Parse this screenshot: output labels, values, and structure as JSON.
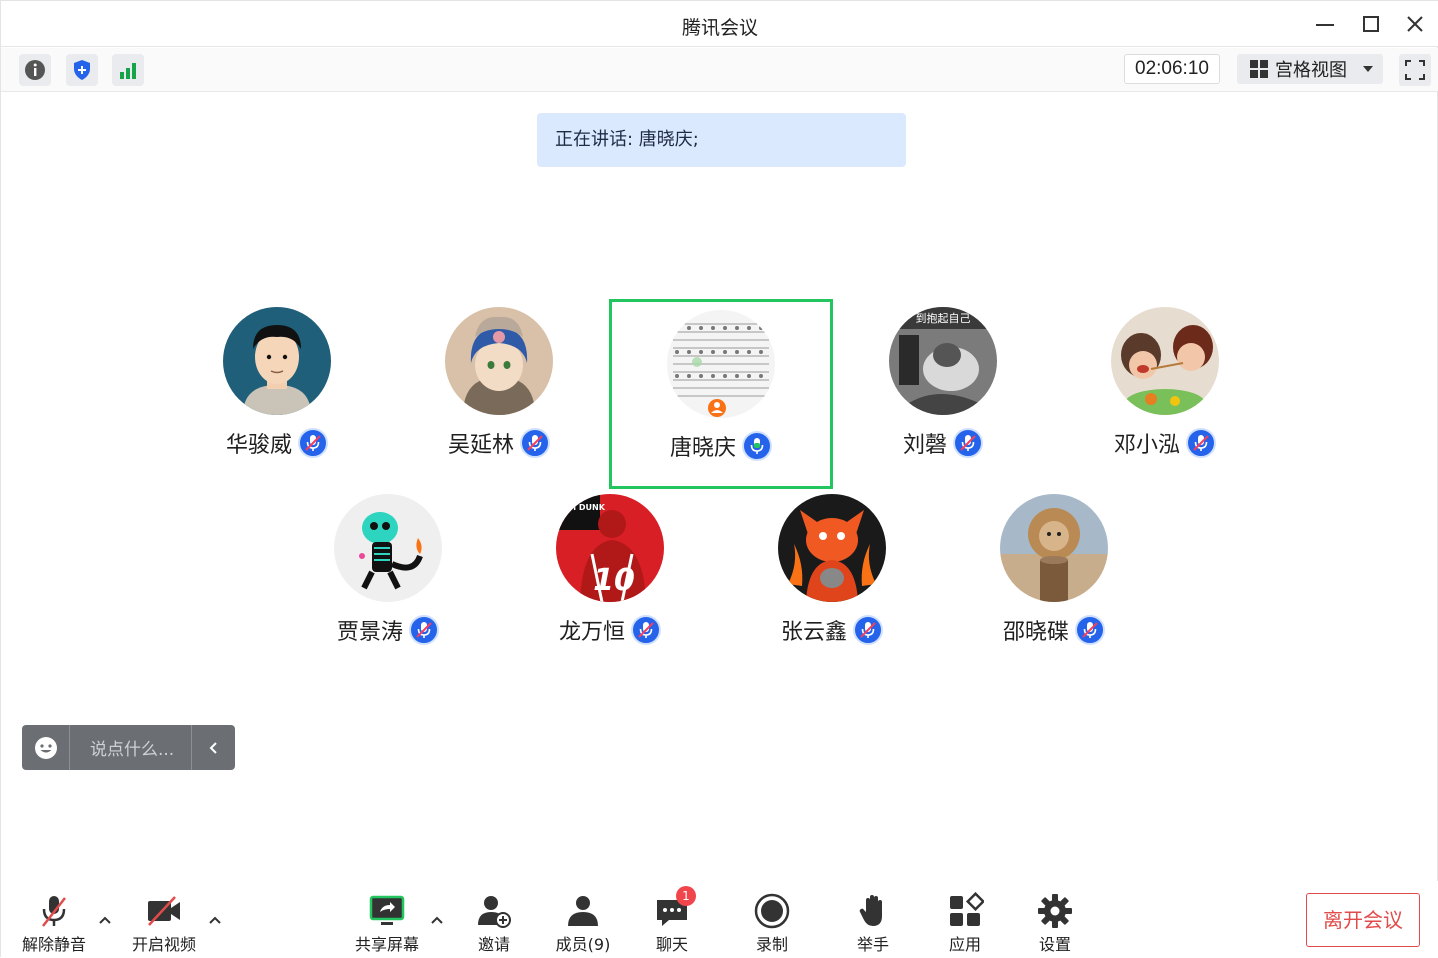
{
  "window": {
    "title": "腾讯会议"
  },
  "toolbar": {
    "timer": "02:06:10",
    "view_label": "宫格视图",
    "icons": [
      "info-icon",
      "shield-icon",
      "signal-icon",
      "fullscreen-icon"
    ]
  },
  "speaking": "正在讲话: 唐晓庆;",
  "participants": [
    {
      "name": "华骏威",
      "mic": "muted",
      "avatar": "portrait-boy"
    },
    {
      "name": "吴延林",
      "mic": "muted",
      "avatar": "anime-girl-boar"
    },
    {
      "name": "唐晓庆",
      "mic": "speaking",
      "avatar": "sheet-music",
      "active": true
    },
    {
      "name": "刘磬",
      "mic": "muted",
      "avatar": "cartoon-cat-bw",
      "avatar_text": "到抱起自己"
    },
    {
      "name": "邓小泓",
      "mic": "muted",
      "avatar": "cartoon-family"
    },
    {
      "name": "贾景涛",
      "mic": "muted",
      "avatar": "skeleton-dino"
    },
    {
      "name": "龙万恒",
      "mic": "muted",
      "avatar": "basketball-10",
      "avatar_text": "SLAM DUNK"
    },
    {
      "name": "张云鑫",
      "mic": "muted",
      "avatar": "red-cartoon-cat"
    },
    {
      "name": "邵晓碟",
      "mic": "muted",
      "avatar": "lion-kitten"
    }
  ],
  "chat": {
    "placeholder": "说点什么..."
  },
  "bottom": {
    "mute": "解除静音",
    "video": "开启视频",
    "share": "共享屏幕",
    "invite": "邀请",
    "members": "成员(9)",
    "chat": "聊天",
    "chat_badge": "1",
    "record": "录制",
    "raise_hand": "举手",
    "apps": "应用",
    "settings": "设置",
    "leave": "离开会议"
  },
  "colors": {
    "active_border": "#22c55e",
    "mic_blue": "#2563eb",
    "leave_red": "#e24b4b",
    "banner_bg": "#dbe9ff"
  }
}
